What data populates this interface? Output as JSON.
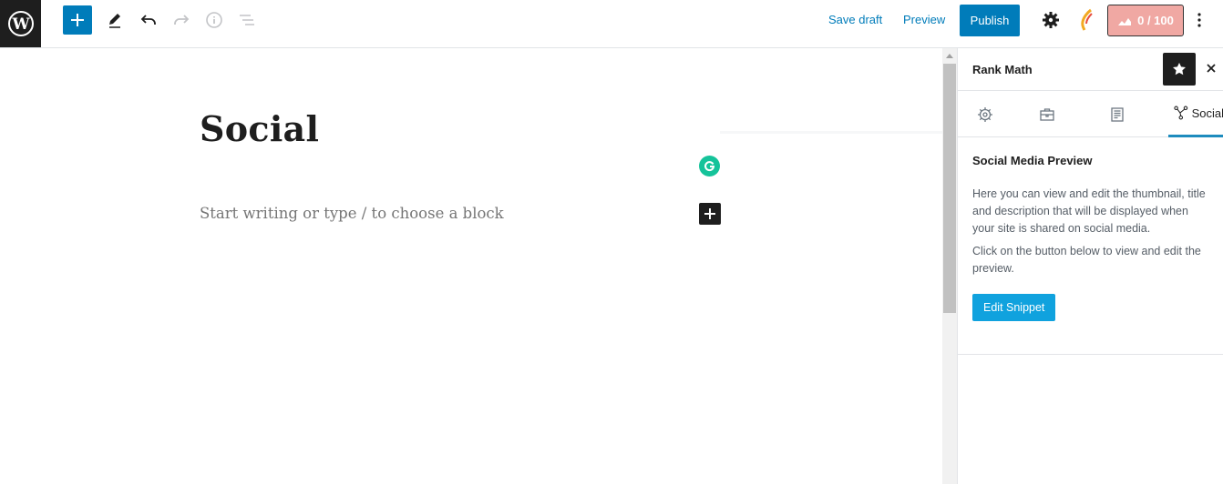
{
  "topbar": {
    "save_draft": "Save draft",
    "preview": "Preview",
    "publish": "Publish",
    "seo_score": "0 / 100",
    "icons": [
      "wordpress-logo-icon",
      "plus-icon",
      "pencil-icon",
      "undo-icon",
      "redo-icon",
      "info-icon",
      "list-view-icon",
      "gear-icon",
      "rank-math-icon",
      "more-vertical-icon"
    ]
  },
  "editor": {
    "title": "Social",
    "placeholder": "Start writing or type / to choose a block"
  },
  "sidebar": {
    "title": "Rank Math",
    "tabs": [
      {
        "icon": "gear-icon",
        "label": ""
      },
      {
        "icon": "briefcase-icon",
        "label": ""
      },
      {
        "icon": "schema-icon",
        "label": ""
      },
      {
        "icon": "social-share-icon",
        "label": "Social"
      }
    ],
    "panel": {
      "heading": "Social Media Preview",
      "desc1": "Here you can view and edit the thumbnail, title and description that will be displayed when your site is shared on social media.",
      "desc2": "Click on the button below to view and edit the preview.",
      "button": "Edit Snippet"
    }
  },
  "colors": {
    "accent": "#007cba",
    "score_bg": "#f0a8a3",
    "edit_snippet": "#10a2de",
    "grammarly": "#15c39a"
  }
}
